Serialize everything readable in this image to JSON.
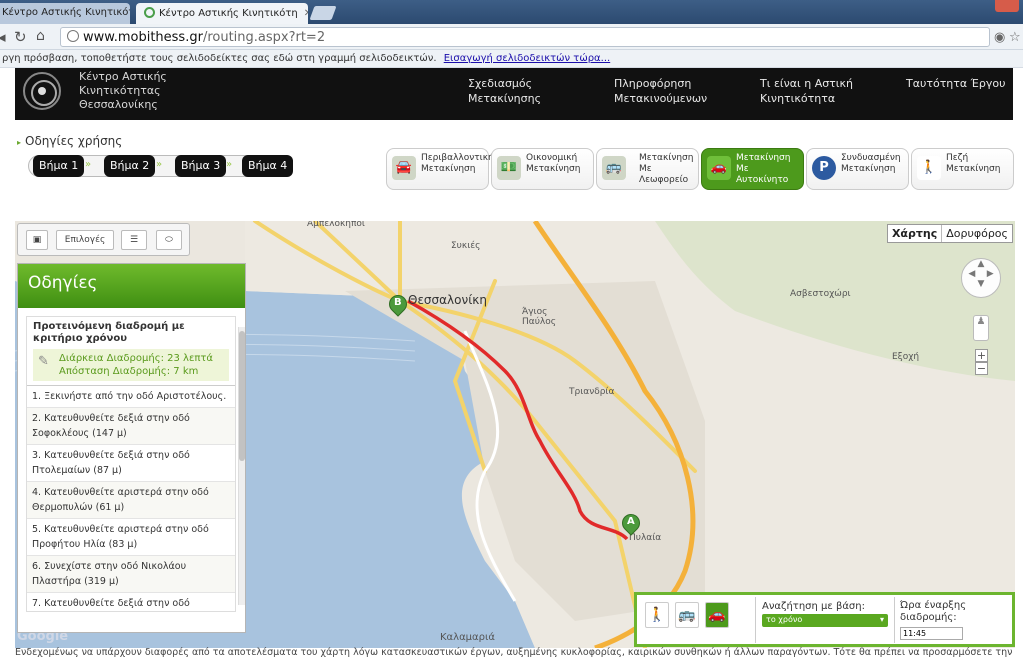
{
  "browser": {
    "tabs": [
      {
        "title": "Κέντρο Αστικής Κινητικότη",
        "active": false
      },
      {
        "title": "Κέντρο Αστικής Κινητικότη",
        "active": true
      }
    ],
    "url_host": "www.mobithess.gr",
    "url_path": "/routing.aspx?rt=2",
    "bookmark_prompt": "ργη πρόσβαση, τοποθετήστε τους σελιδοδείκτες σας εδώ στη γραμμή σελιδοδεικτών.",
    "bookmark_link": "Εισαγωγή σελιδοδεικτών τώρα..."
  },
  "site": {
    "logo_text": [
      "Κέντρο Αστικής",
      "Κινητικότητας",
      "Θεσσαλονίκης"
    ],
    "menu": [
      {
        "line1": "Σχεδιασμός",
        "line2": "Μετακίνησης"
      },
      {
        "line1": "Πληροφόρηση",
        "line2": "Μετακινούμενων"
      },
      {
        "line1": "Τι είναι η Αστική",
        "line2": "Κινητικότητα"
      },
      {
        "line1": "Ταυτότητα Έργου",
        "line2": ""
      }
    ]
  },
  "usage": {
    "title": "Οδηγίες χρήσης",
    "steps": [
      "Βήμα 1",
      "Βήμα 2",
      "Βήμα 3",
      "Βήμα 4"
    ]
  },
  "modes": [
    {
      "icon": "🚘",
      "line1": "Περιβαλλοντική",
      "line2": "Μετακίνηση",
      "line3": "",
      "active": false
    },
    {
      "icon": "💵",
      "line1": "Οικονομική",
      "line2": "Μετακίνηση",
      "line3": "",
      "active": false
    },
    {
      "icon": "🚌",
      "line1": "Μετακίνηση",
      "line2": "Με",
      "line3": "Λεωφορείο",
      "active": false
    },
    {
      "icon": "🚗",
      "line1": "Μετακίνηση Με",
      "line2": "Αυτοκίνητο",
      "line3": "",
      "active": true
    },
    {
      "icon": "P",
      "line1": "Συνδυασμένη",
      "line2": "Μετακίνηση",
      "line3": "",
      "active": false
    },
    {
      "icon": "🚶",
      "line1": "Πεζή",
      "line2": "Μετακίνηση",
      "line3": "",
      "active": false
    }
  ],
  "tools": {
    "options_label": "Επιλογές"
  },
  "map": {
    "type_options": [
      "Χάρτης",
      "Δορυφόρος"
    ],
    "labels": [
      "Αμπελόκηποι",
      "Συκιές",
      "Θεσσαλονίκη",
      "Άγιος Παύλος",
      "Τριανδρία",
      "Ασβεστοχώρι",
      "Εξοχή",
      "Καλαμαριά",
      "Πυλαία"
    ],
    "marker_start": "A",
    "marker_end": "B",
    "attribution": "Google"
  },
  "directions": {
    "title": "Οδηγίες",
    "recommended_title": "Προτεινόμενη διαδρομή με κριτήριο χρόνου",
    "duration": "Διάρκεια Διαδρομής: 23 λεπτά",
    "distance": "Απόσταση Διαδρομής: 7 km",
    "steps": [
      "1. Ξεκινήστε από την οδό Αριστοτέλους.",
      "2. Κατευθυνθείτε δεξιά στην οδό Σοφοκλέους (147 μ)",
      "3. Κατευθυνθείτε δεξιά στην οδό Πτολεμαίων (87 μ)",
      "4. Κατευθυνθείτε αριστερά στην οδό Θερμοπυλών (61 μ)",
      "5. Κατευθυνθείτε αριστερά στην οδό Προφήτου Ηλία (83 μ)",
      "6. Συνεχίστε στην οδό Νικολάου Πλαστήρα (319 μ)",
      "7. Κατευθυνθείτε δεξιά στην οδό"
    ]
  },
  "search": {
    "mode_icons": [
      "🚶",
      "🚌",
      "🚗"
    ],
    "search_by_label": "Αναζήτηση με βάση:",
    "search_by_value": "το χρόνο",
    "start_time_label1": "Ώρα έναρξης",
    "start_time_label2": "διαδρομής:",
    "start_time_value": "11:45"
  },
  "disclaimer": "Ενδεχομένως να υπάρχουν διαφορές από τα αποτελέσματα του χάρτη λόγω κατασκευαστικών έργων, αυξημένης κυκλοφορίας, καιρικών συνθηκών ή άλλων παραγόντων. Τότε θα πρέπει να προσαρμόσετε την"
}
